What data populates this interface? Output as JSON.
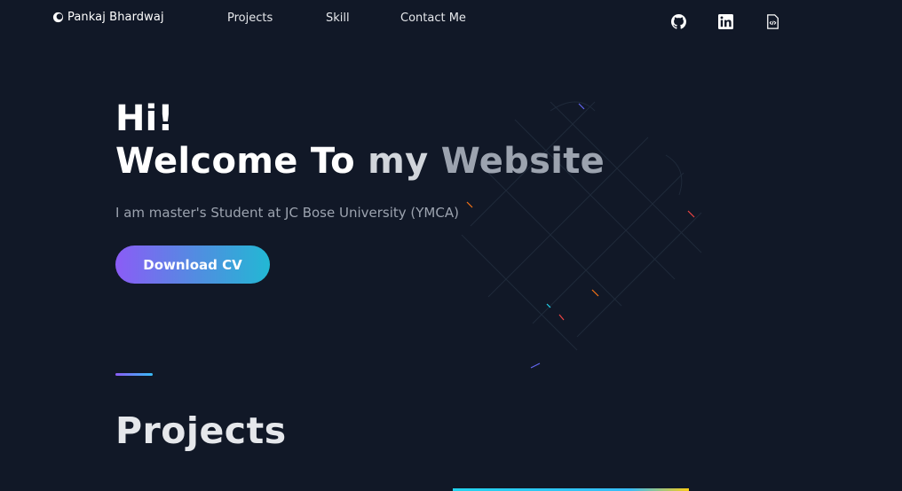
{
  "nav": {
    "brand": "Pankaj Bhardwaj",
    "links": [
      "Projects",
      "Skill",
      "Contact Me"
    ],
    "social_icons": [
      "github-icon",
      "linkedin-icon",
      "code-file-icon"
    ]
  },
  "hero": {
    "greeting": "Hi!",
    "welcome_1": "Welcome To ",
    "welcome_2": "my ",
    "welcome_3": "Website",
    "subtitle": "I am master's Student at JC Bose University (YMCA)",
    "cta_label": "Download CV"
  },
  "sections": {
    "projects_title": "Projects"
  },
  "colors": {
    "background": "#111827",
    "gradient_start": "#8b5cf6",
    "gradient_end": "#22b8d4",
    "text_muted": "#9ca3af"
  }
}
